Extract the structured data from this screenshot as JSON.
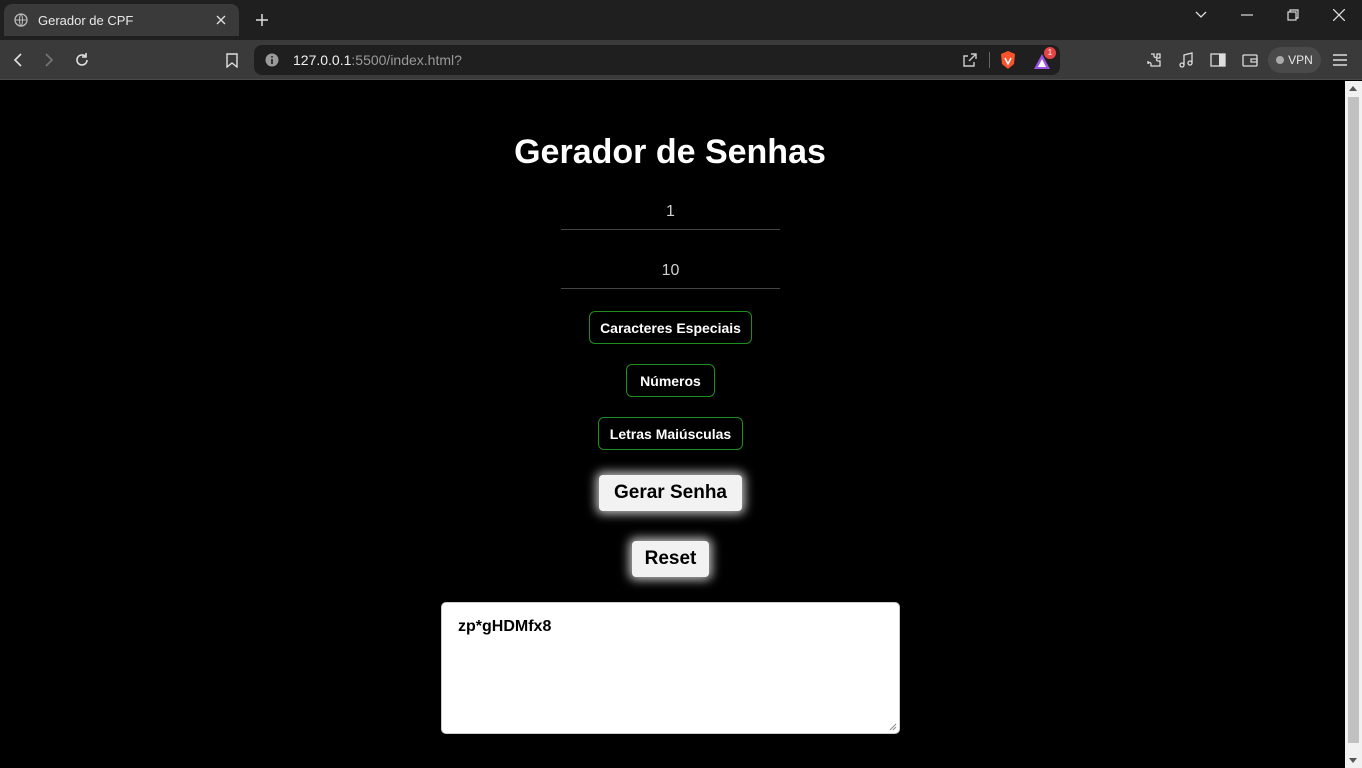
{
  "browser": {
    "tab_title": "Gerador de CPF",
    "url_host": "127.0.0.1",
    "url_rest": ":5500/index.html?",
    "vpn_label": "VPN",
    "rewards_badge": "1"
  },
  "page": {
    "title": "Gerador de Senhas",
    "field_1_value": "1",
    "field_2_value": "10",
    "options": {
      "special": "Caracteres Especiais",
      "numbers": "Números",
      "uppercase": "Letras Maiúsculas"
    },
    "generate_label": "Gerar Senha",
    "reset_label": "Reset",
    "output_value": "zp*gHDMfx8"
  },
  "colors": {
    "page_bg": "#000000",
    "option_border": "#1e8e1e",
    "chrome_toolbar": "#3a3a3a",
    "chrome_tabstrip": "#1f1f1f"
  },
  "icons": [
    "globe-icon",
    "close-icon",
    "plus-icon",
    "chevron-down-icon",
    "minimize-icon",
    "restore-icon",
    "back-icon",
    "forward-icon",
    "reload-icon",
    "bookmark-icon",
    "info-icon",
    "share-icon",
    "brave-shield-icon",
    "brave-rewards-icon",
    "extensions-icon",
    "music-icon",
    "sidebar-icon",
    "wallet-icon",
    "menu-icon"
  ]
}
